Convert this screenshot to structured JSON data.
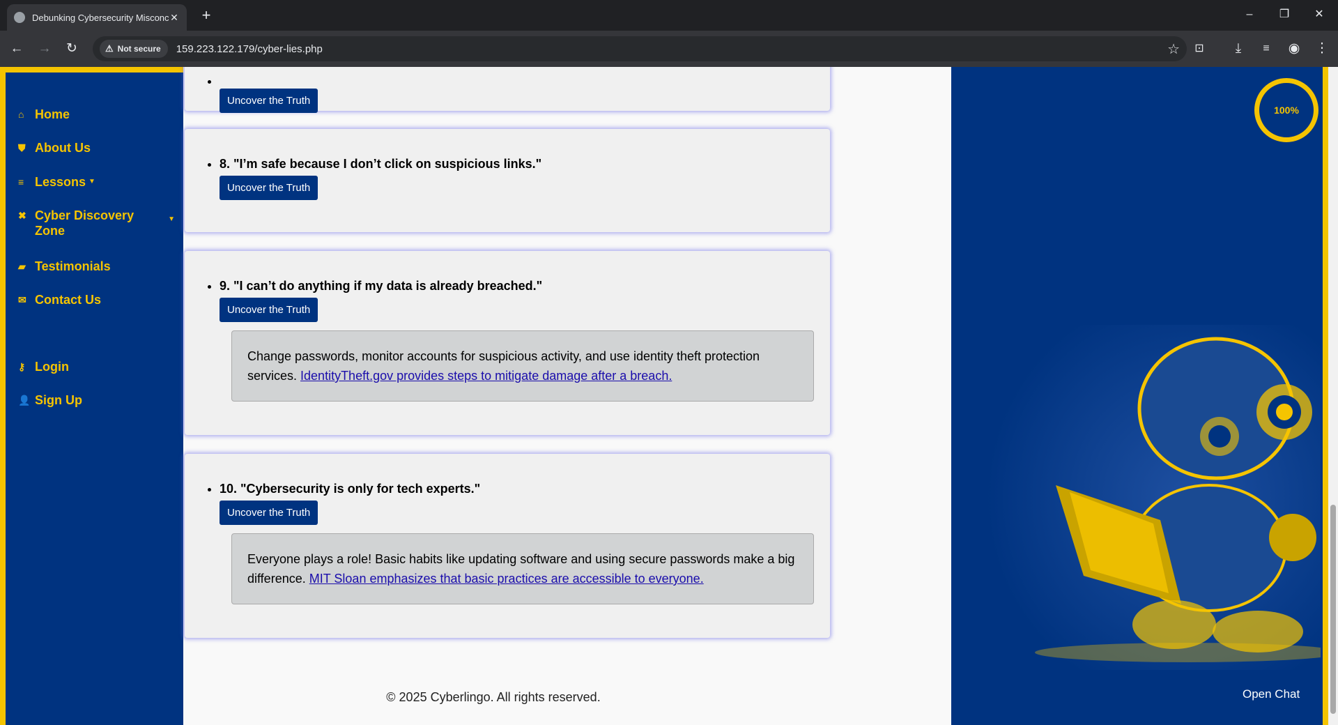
{
  "browser": {
    "tab_title": "Debunking Cybersecurity Misconc",
    "security_label": "Not secure",
    "url": "159.223.122.179/cyber-lies.php"
  },
  "sidebar": {
    "items": [
      {
        "label": "Home",
        "icon": "home-icon"
      },
      {
        "label": "About Us",
        "icon": "shield-icon"
      },
      {
        "label": "Lessons",
        "icon": "list-icon"
      },
      {
        "label": "Cyber Discovery Zone",
        "icon": "puzzle-icon"
      },
      {
        "label": "Testimonials",
        "icon": "comment-icon"
      },
      {
        "label": "Contact Us",
        "icon": "envelope-icon"
      },
      {
        "label": "Login",
        "icon": "key-icon"
      },
      {
        "label": "Sign Up",
        "icon": "user-icon"
      }
    ]
  },
  "myths": [
    {
      "title": "",
      "button": "Uncover the Truth"
    },
    {
      "title": "8. \"I’m safe because I don’t click on suspicious links.\"",
      "button": "Uncover the Truth"
    },
    {
      "title": "9. \"I can’t do anything if my data is already breached.\"",
      "button": "Uncover the Truth",
      "truth": "Change passwords, monitor accounts for suspicious activity, and use identity theft protection services.",
      "link": "IdentityTheft.gov provides steps to mitigate damage after a breach."
    },
    {
      "title": "10. \"Cybersecurity is only for tech experts.\"",
      "button": "Uncover the Truth",
      "truth": "Everyone plays a role! Basic habits like updating software and using secure passwords make a big difference.",
      "link": "MIT Sloan emphasizes that basic practices are accessible to everyone."
    }
  ],
  "footer": "© 2025 Cyberlingo. All rights reserved.",
  "progress": {
    "value": "100%",
    "fraction": 1.0
  },
  "chat_label": "Open Chat",
  "colors": {
    "brand": "#003380",
    "accent": "#f5c400"
  }
}
